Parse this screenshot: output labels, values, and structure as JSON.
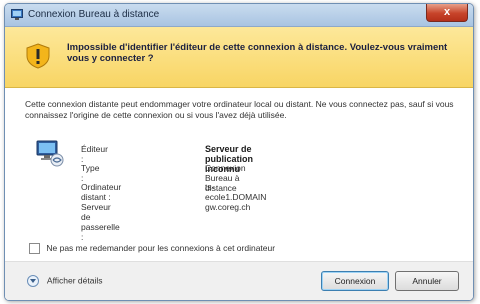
{
  "window": {
    "title": "Connexion Bureau à distance",
    "close_label": "x"
  },
  "banner": {
    "message": "Impossible d'identifier l'éditeur de cette connexion à distance. Voulez-vous vraiment vous y connecter ?"
  },
  "description": "Cette connexion distante peut endommager votre ordinateur local ou distant. Ne vous connectez pas, sauf si vous connaissez l'origine de cette connexion ou si vous l'avez déjà utilisée.",
  "details": [
    {
      "label": "Éditeur :",
      "value": "Serveur de publication inconnu"
    },
    {
      "label": "Type :",
      "value": "Connexion Bureau à distance"
    },
    {
      "label": "Ordinateur distant :",
      "value": "ts-ecole1.DOMAIN"
    },
    {
      "label": "Serveur de passerelle :",
      "value": "gw.coreg.ch"
    }
  ],
  "checkbox": {
    "label": "Ne pas me redemander pour les connexions à cet ordinateur",
    "checked": false
  },
  "footer": {
    "details_label": "Afficher détails",
    "connect_label": "Connexion",
    "cancel_label": "Annuler"
  },
  "colors": {
    "banner": "#f8d564",
    "close_button": "#c7442a",
    "titlebar": "#b9d0ea"
  },
  "icons": {
    "app": "remote-desktop-icon",
    "warning": "warning-shield-icon",
    "computer": "remote-computer-icon"
  }
}
